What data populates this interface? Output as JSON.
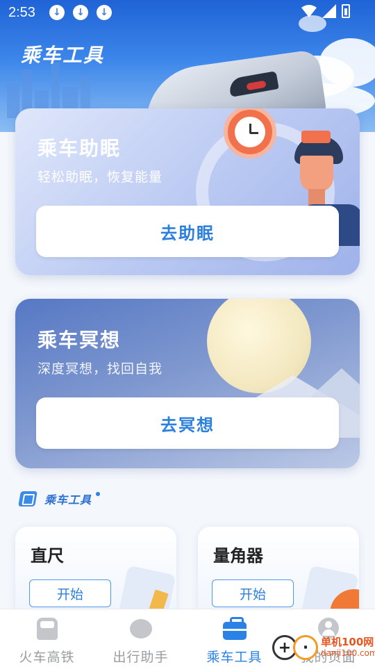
{
  "status_bar": {
    "time": "2:53"
  },
  "header": {
    "title": "乘车工具"
  },
  "cards": [
    {
      "title": "乘车助眠",
      "subtitle": "轻松助眠，恢复能量",
      "button_label": "去助眠"
    },
    {
      "title": "乘车冥想",
      "subtitle": "深度冥想，找回自我",
      "button_label": "去冥想"
    }
  ],
  "tools_section": {
    "title": "乘车工具",
    "tools": [
      {
        "title": "直尺",
        "button_label": "开始"
      },
      {
        "title": "量角器",
        "button_label": "开始"
      }
    ]
  },
  "bottom_nav": {
    "items": [
      {
        "label": "火车高铁",
        "icon": "train-icon",
        "active": false
      },
      {
        "label": "出行助手",
        "icon": "chat-icon",
        "active": false
      },
      {
        "label": "乘车工具",
        "icon": "toolbox-icon",
        "active": true
      },
      {
        "label": "我的页面",
        "icon": "person-icon",
        "active": false
      }
    ]
  },
  "watermark": {
    "text_cn": "单机100网",
    "text_en": "danji100.com"
  },
  "colors": {
    "accent": "#2b82e6",
    "inactive": "#9a9ca2"
  }
}
